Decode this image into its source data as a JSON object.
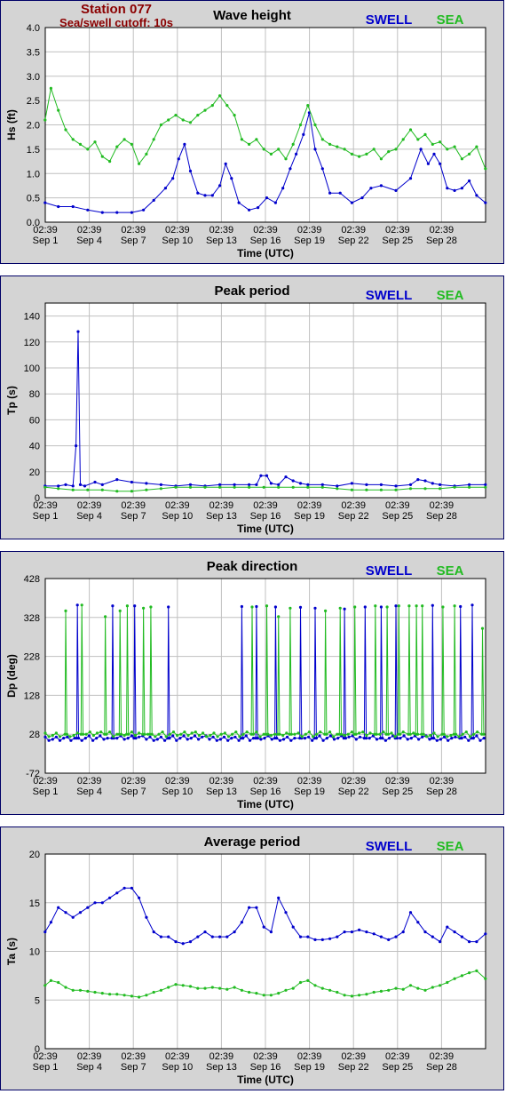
{
  "header": {
    "station": "Station 077",
    "cutoff": "Sea/swell cutoff: 10s"
  },
  "legend": {
    "swell": "SWELL",
    "sea": "SEA"
  },
  "colors": {
    "swell": "#0000cc",
    "sea": "#22bb22",
    "plot_bg": "#ffffff",
    "panel_bg": "#d4d4d4",
    "grid": "#c0c0c0"
  },
  "x_axis": {
    "label": "Time (UTC)",
    "tick_time": "02:39",
    "tick_dates": [
      "Sep 1",
      "Sep 4",
      "Sep 7",
      "Sep 10",
      "Sep 13",
      "Sep 16",
      "Sep 19",
      "Sep 22",
      "Sep 25",
      "Sep 28"
    ],
    "range_days": [
      1.11,
      31.11
    ]
  },
  "chart_data": [
    {
      "type": "line",
      "title": "Wave height",
      "ylabel": "Hs (ft)",
      "ylim": [
        0.0,
        4.0
      ],
      "yticks": [
        "0.0",
        "0.5",
        "1.0",
        "1.5",
        "2.0",
        "2.5",
        "3.0",
        "3.5",
        "4.0"
      ],
      "series": [
        {
          "name": "SWELL",
          "x": [
            1.1,
            2,
            3,
            4,
            5,
            6,
            7,
            7.8,
            8.5,
            9.3,
            9.8,
            10.2,
            10.6,
            11,
            11.5,
            12,
            12.5,
            13,
            13.4,
            13.8,
            14.3,
            15,
            15.6,
            16.2,
            16.8,
            17.3,
            17.8,
            18.2,
            18.7,
            19.1,
            19.5,
            20,
            20.5,
            21.2,
            22,
            22.7,
            23.3,
            24,
            25,
            26,
            26.7,
            27.2,
            27.6,
            28,
            28.5,
            29,
            29.5,
            30,
            30.5,
            31.1
          ],
          "values": [
            0.4,
            0.32,
            0.32,
            0.25,
            0.2,
            0.2,
            0.2,
            0.25,
            0.45,
            0.7,
            0.9,
            1.3,
            1.6,
            1.05,
            0.6,
            0.55,
            0.55,
            0.75,
            1.2,
            0.9,
            0.4,
            0.25,
            0.3,
            0.5,
            0.4,
            0.7,
            1.1,
            1.4,
            1.8,
            2.25,
            1.5,
            1.1,
            0.6,
            0.6,
            0.4,
            0.5,
            0.7,
            0.75,
            0.65,
            0.9,
            1.5,
            1.2,
            1.4,
            1.2,
            0.7,
            0.65,
            0.7,
            0.85,
            0.55,
            0.4
          ]
        },
        {
          "name": "SEA",
          "x": [
            1.1,
            1.5,
            2,
            2.5,
            3,
            3.5,
            4,
            4.5,
            5,
            5.5,
            6,
            6.5,
            7,
            7.5,
            8,
            8.5,
            9,
            9.5,
            10,
            10.5,
            11,
            11.5,
            12,
            12.5,
            13,
            13.5,
            14,
            14.5,
            15,
            15.5,
            16,
            16.5,
            17,
            17.5,
            18,
            18.5,
            19,
            19.5,
            20,
            20.5,
            21,
            21.5,
            22,
            22.5,
            23,
            23.5,
            24,
            24.5,
            25,
            25.5,
            26,
            26.5,
            27,
            27.5,
            28,
            28.5,
            29,
            29.5,
            30,
            30.5,
            31.1
          ],
          "values": [
            2.1,
            2.75,
            2.3,
            1.9,
            1.7,
            1.6,
            1.5,
            1.65,
            1.35,
            1.25,
            1.55,
            1.7,
            1.6,
            1.2,
            1.4,
            1.7,
            2.0,
            2.1,
            2.2,
            2.1,
            2.05,
            2.2,
            2.3,
            2.4,
            2.6,
            2.4,
            2.2,
            1.7,
            1.6,
            1.7,
            1.5,
            1.4,
            1.5,
            1.3,
            1.6,
            2.0,
            2.4,
            2.0,
            1.7,
            1.6,
            1.55,
            1.5,
            1.4,
            1.35,
            1.4,
            1.5,
            1.3,
            1.45,
            1.5,
            1.7,
            1.9,
            1.7,
            1.8,
            1.6,
            1.65,
            1.5,
            1.55,
            1.3,
            1.4,
            1.55,
            1.1
          ]
        }
      ]
    },
    {
      "type": "line",
      "title": "Peak period",
      "ylabel": "Tp (s)",
      "ylim": [
        0,
        150
      ],
      "yticks": [
        "0",
        "20",
        "40",
        "60",
        "80",
        "100",
        "120",
        "140"
      ],
      "series": [
        {
          "name": "SWELL",
          "x": [
            1.1,
            2,
            2.5,
            3,
            3.2,
            3.35,
            3.5,
            3.8,
            4.5,
            5,
            6,
            7,
            8,
            9,
            10,
            11,
            12,
            13,
            14,
            15,
            15.5,
            15.8,
            16.2,
            16.5,
            17,
            17.5,
            18,
            18.5,
            19,
            20,
            21,
            22,
            23,
            24,
            25,
            26,
            26.5,
            27,
            27.5,
            28,
            29,
            30,
            31.1
          ],
          "values": [
            9,
            9,
            10,
            9,
            40,
            128,
            10,
            9,
            12,
            10,
            14,
            12,
            11,
            10,
            9,
            10,
            9,
            10,
            10,
            10,
            10,
            17,
            17,
            11,
            10,
            16,
            13,
            11,
            10,
            10,
            9,
            11,
            10,
            10,
            9,
            10,
            14,
            13,
            11,
            10,
            9,
            10,
            10
          ]
        },
        {
          "name": "SEA",
          "x": [
            1.1,
            2,
            3,
            4,
            5,
            6,
            7,
            8,
            9,
            10,
            11,
            12,
            13,
            14,
            15,
            16,
            17,
            18,
            19,
            20,
            21,
            22,
            23,
            24,
            25,
            26,
            27,
            28,
            29,
            30,
            31.1
          ],
          "values": [
            8,
            7,
            6,
            6,
            6,
            5,
            5,
            6,
            7,
            8,
            8,
            8,
            8,
            8,
            8,
            8,
            8,
            8,
            8,
            8,
            7,
            6,
            6,
            6,
            6,
            7,
            7,
            7,
            8,
            8,
            8
          ]
        }
      ]
    },
    {
      "type": "line",
      "title": "Peak direction",
      "ylabel": "Dp (deg)",
      "ylim": [
        -72,
        428
      ],
      "yticks": [
        "-72",
        "28",
        "128",
        "228",
        "328",
        "428"
      ],
      "series": [
        {
          "name": "SWELL",
          "baseline": 18,
          "spike_x": [
            3.3,
            5.7,
            7.2,
            9.5,
            14.5,
            15.5,
            16.8,
            18.5,
            19.5,
            21.5,
            22.9,
            24.0,
            25.0,
            27.5,
            29.4,
            30.2
          ],
          "spike_values": [
            360,
            358,
            358,
            355,
            356,
            356,
            355,
            354,
            352,
            350,
            355,
            355,
            358,
            359,
            356,
            360
          ]
        },
        {
          "name": "SEA",
          "baseline": 28,
          "spike_x": [
            2.5,
            3.6,
            5.2,
            6.2,
            6.7,
            7.8,
            8.3,
            15.2,
            16.2,
            17.0,
            17.8,
            20.2,
            21.2,
            22.2,
            23.6,
            24.4,
            25.2,
            25.9,
            26.4,
            26.8,
            28.2,
            29.0,
            30.9
          ],
          "spike_values": [
            345,
            360,
            330,
            345,
            358,
            352,
            355,
            355,
            358,
            330,
            352,
            345,
            352,
            355,
            358,
            355,
            358,
            358,
            358,
            358,
            355,
            358,
            300
          ]
        }
      ]
    },
    {
      "type": "line",
      "title": "Average period",
      "ylabel": "Ta (s)",
      "ylim": [
        0,
        20
      ],
      "yticks": [
        "0",
        "5",
        "10",
        "15",
        "20"
      ],
      "series": [
        {
          "name": "SWELL",
          "x": [
            1.1,
            1.5,
            2,
            2.5,
            3,
            3.5,
            4,
            4.5,
            5,
            5.5,
            6,
            6.5,
            7,
            7.5,
            8,
            8.5,
            9,
            9.5,
            10,
            10.5,
            11,
            11.5,
            12,
            12.5,
            13,
            13.5,
            14,
            14.5,
            15,
            15.5,
            16,
            16.5,
            17,
            17.5,
            18,
            18.5,
            19,
            19.5,
            20,
            20.5,
            21,
            21.5,
            22,
            22.5,
            23,
            23.5,
            24,
            24.5,
            25,
            25.5,
            26,
            26.5,
            27,
            27.5,
            28,
            28.5,
            29,
            29.5,
            30,
            30.5,
            31.1
          ],
          "values": [
            12.0,
            13.0,
            14.5,
            14.0,
            13.5,
            14.0,
            14.5,
            15.0,
            15.0,
            15.5,
            16.0,
            16.5,
            16.5,
            15.5,
            13.5,
            12.0,
            11.5,
            11.5,
            11.0,
            10.8,
            11.0,
            11.5,
            12.0,
            11.5,
            11.5,
            11.5,
            12.0,
            13.0,
            14.5,
            14.5,
            12.5,
            12.0,
            15.5,
            14.0,
            12.5,
            11.5,
            11.5,
            11.2,
            11.2,
            11.3,
            11.5,
            12.0,
            12.0,
            12.2,
            12.0,
            11.8,
            11.5,
            11.2,
            11.5,
            12.0,
            14.0,
            13.0,
            12.0,
            11.5,
            11.0,
            12.5,
            12.0,
            11.5,
            11.0,
            11.0,
            11.8
          ]
        },
        {
          "name": "SEA",
          "x": [
            1.1,
            1.5,
            2,
            2.5,
            3,
            3.5,
            4,
            4.5,
            5,
            5.5,
            6,
            6.5,
            7,
            7.5,
            8,
            8.5,
            9,
            9.5,
            10,
            10.5,
            11,
            11.5,
            12,
            12.5,
            13,
            13.5,
            14,
            14.5,
            15,
            15.5,
            16,
            16.5,
            17,
            17.5,
            18,
            18.5,
            19,
            19.5,
            20,
            20.5,
            21,
            21.5,
            22,
            22.5,
            23,
            23.5,
            24,
            24.5,
            25,
            25.5,
            26,
            26.5,
            27,
            27.5,
            28,
            28.5,
            29,
            29.5,
            30,
            30.5,
            31.1
          ],
          "values": [
            6.5,
            7.0,
            6.8,
            6.3,
            6.0,
            6.0,
            5.9,
            5.8,
            5.7,
            5.6,
            5.6,
            5.5,
            5.4,
            5.3,
            5.5,
            5.8,
            6.0,
            6.3,
            6.6,
            6.5,
            6.4,
            6.2,
            6.2,
            6.3,
            6.2,
            6.1,
            6.3,
            6.0,
            5.8,
            5.7,
            5.5,
            5.5,
            5.7,
            6.0,
            6.2,
            6.8,
            7.0,
            6.5,
            6.2,
            6.0,
            5.8,
            5.5,
            5.4,
            5.5,
            5.6,
            5.8,
            5.9,
            6.0,
            6.2,
            6.1,
            6.5,
            6.2,
            6.0,
            6.3,
            6.5,
            6.8,
            7.2,
            7.5,
            7.8,
            8.0,
            7.2
          ]
        }
      ]
    }
  ]
}
